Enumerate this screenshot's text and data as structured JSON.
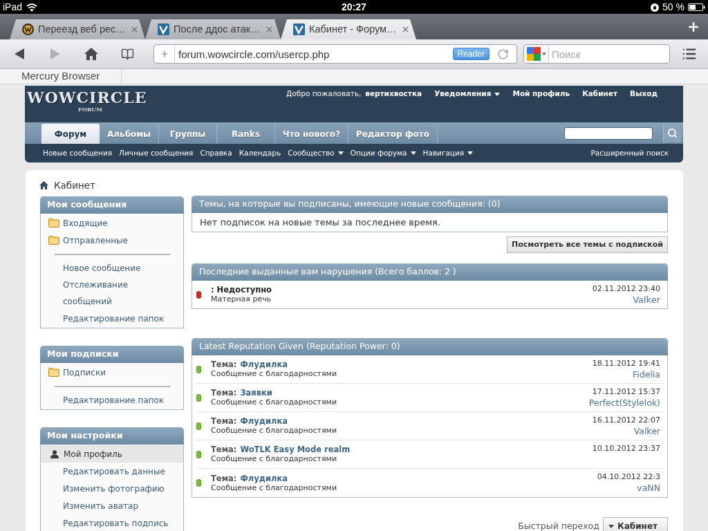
{
  "status_bar": {
    "device": "iPad",
    "time": "20:27",
    "battery": "50 %"
  },
  "browser_tabs": [
    {
      "title": "Переезд веб рес…",
      "kind": "emblem",
      "selected": false
    },
    {
      "title": "После ддос атак…",
      "kind": "square",
      "selected": false
    },
    {
      "title": "Кабинет - Форум…",
      "kind": "square",
      "selected": true
    }
  ],
  "toolbar": {
    "buttons": [
      {
        "kind": "back",
        "disabled": false
      },
      {
        "kind": "forward",
        "disabled": true
      },
      {
        "kind": "home",
        "disabled": false
      },
      {
        "kind": "bookmarks",
        "disabled": false
      }
    ]
  },
  "address_bar": {
    "url": "forum.wowcircle.com/usercp.php",
    "reader_button": "Reader"
  },
  "search_field": {
    "placeholder": "Поиск"
  },
  "bookmarks_bar": {
    "items": [
      "Mercury Browser"
    ]
  },
  "forum_header": {
    "logo": "WOWCIRCLE",
    "logo_subtitle": "FORUM",
    "welcome": "Добро пожаловать,",
    "username": "вертихвостка",
    "links": [
      {
        "label": "Уведомления",
        "dropdown": true
      },
      {
        "label": "Мой профиль",
        "dropdown": false
      },
      {
        "label": "Кабинет",
        "dropdown": false
      },
      {
        "label": "Выход",
        "dropdown": false
      }
    ]
  },
  "nav_tabs": [
    {
      "label": "Форум",
      "selected": true
    },
    {
      "label": "Альбомы",
      "selected": false
    },
    {
      "label": "Группы",
      "selected": false
    },
    {
      "label": "Ranks",
      "selected": false
    },
    {
      "label": "Что нового?",
      "selected": false
    },
    {
      "label": "Редактор фото",
      "selected": false
    }
  ],
  "sub_nav": {
    "links": [
      {
        "label": "Новые сообщения",
        "dropdown": false
      },
      {
        "label": "Личные сообщения",
        "dropdown": false
      },
      {
        "label": "Справка",
        "dropdown": false
      },
      {
        "label": "Календарь",
        "dropdown": false
      },
      {
        "label": "Сообщество",
        "dropdown": true
      },
      {
        "label": "Опции форума",
        "dropdown": true
      },
      {
        "label": "Навигация",
        "dropdown": true
      }
    ],
    "advanced_search": "Расширенный поиск"
  },
  "breadcrumb": {
    "current": "Кабинет"
  },
  "sidebar": [
    {
      "title": "Мои сообщения",
      "items": [
        {
          "kind": "folder",
          "label": "Входящие"
        },
        {
          "kind": "folder",
          "label": "Отправленные"
        },
        {
          "kind": "divider"
        },
        {
          "kind": "link",
          "label": "Новое сообщение"
        },
        {
          "kind": "link",
          "label": "Отслеживание сообщений"
        },
        {
          "kind": "link",
          "label": "Редактирование папок"
        }
      ]
    },
    {
      "title": "Мои подписки",
      "items": [
        {
          "kind": "folder",
          "label": "Подписки"
        },
        {
          "kind": "divider"
        },
        {
          "kind": "link",
          "label": "Редактирование папок"
        }
      ]
    },
    {
      "title": "Мои настройки",
      "items": [
        {
          "kind": "section",
          "label": "Мой профиль"
        },
        {
          "kind": "link",
          "label": "Редактировать данные"
        },
        {
          "kind": "link",
          "label": "Изменить фотографию"
        },
        {
          "kind": "link",
          "label": "Изменить аватар"
        },
        {
          "kind": "link",
          "label": "Редактировать подпись"
        }
      ]
    }
  ],
  "subscribed_threads": {
    "title": "Темы, на которые вы подписаны, имеющие новые сообщения: (0)",
    "message": "Нет подписок на новые темы за последнее время.",
    "button": "Посмотреть все темы с подпиской"
  },
  "infractions": {
    "title": "Последние выданные вам нарушения (Всего баллов: 2 )",
    "items": [
      {
        "title": ": Недоступно",
        "reason": "Матерная речь",
        "date": "02.11.2012 23:40",
        "user": "Valker"
      }
    ]
  },
  "reputation": {
    "title": "Latest Reputation Given (Reputation Power: 0)",
    "items": [
      {
        "label": "Тема:",
        "thread": "Флудилка",
        "comment": "Сообщение с благодарностями",
        "date": "18.11.2012 19:41",
        "user": "Fidelia"
      },
      {
        "label": "Тема:",
        "thread": "Заявки",
        "comment": "Сообщение с благодарностями",
        "date": "17.11.2012 15:37",
        "user": "Perfect(Stylelok)"
      },
      {
        "label": "Тема:",
        "thread": "Флудилка",
        "comment": "Сообщение с благодарностями",
        "date": "16.11.2012 22:07",
        "user": "Valker"
      },
      {
        "label": "Тема:",
        "thread": "WoTLK Easy Mode realm",
        "comment": "Сообщение с благодарностями",
        "date": "10.10.2012 23:37"
      },
      {
        "label": "Тема:",
        "thread": "Флудилка",
        "comment": "Сообщение с благодарностями",
        "date": "04.10.2012 22:3",
        "user": "vaNN"
      }
    ]
  },
  "quick_nav": {
    "label": "Быстрый переход",
    "button": "Кабинет"
  }
}
